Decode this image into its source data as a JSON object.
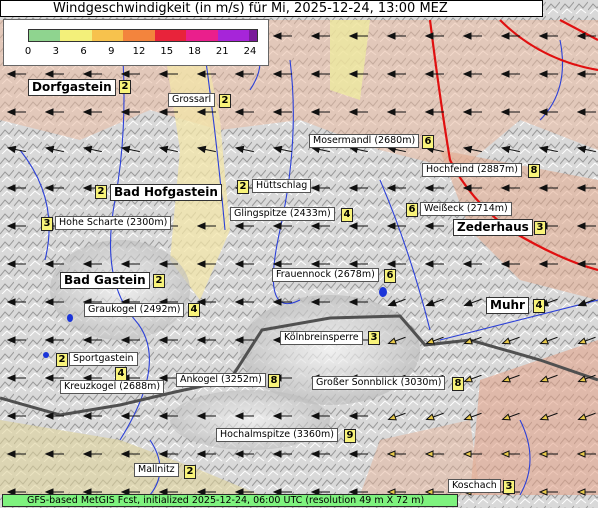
{
  "title": "Windgeschwindigkeit (in m/s) für Mi, 2025-12-24, 13:00 MEZ",
  "legend": {
    "ticks": [
      "0",
      "3",
      "6",
      "9",
      "12",
      "15",
      "18",
      "21",
      "24"
    ],
    "colors": [
      "#8fd48f",
      "#f3f07a",
      "#f7c24d",
      "#f3843d",
      "#e8233a",
      "#ea1f8c",
      "#a625d9",
      "#7a1b9a"
    ]
  },
  "towns": [
    {
      "name": "Dorfgastein",
      "value": "2"
    },
    {
      "name": "Bad Hofgastein",
      "value": "2"
    },
    {
      "name": "Bad Gastein",
      "value": "2"
    },
    {
      "name": "Zederhaus",
      "value": "3"
    },
    {
      "name": "Muhr",
      "value": "4"
    }
  ],
  "peaks": [
    {
      "name": "Grossarl",
      "value": "2"
    },
    {
      "name": "Mosermandl (2680m)",
      "value": "6"
    },
    {
      "name": "Hochfeind (2887m)",
      "value": "8"
    },
    {
      "name": "Hüttschlag",
      "value": "2"
    },
    {
      "name": "Weißeck (2714m)",
      "value": "6"
    },
    {
      "name": "Hohe Scharte (2300m)",
      "value": "3"
    },
    {
      "name": "Glingspitze (2433m)",
      "value": "4"
    },
    {
      "name": "Frauennock (2678m)",
      "value": "6"
    },
    {
      "name": "Graukogel (2492m)",
      "value": "4"
    },
    {
      "name": "Kölnbreinsperre",
      "value": "3"
    },
    {
      "name": "Sportgastein",
      "value": "2"
    },
    {
      "name": "Kreuzkogel (2688m)",
      "value": "4"
    },
    {
      "name": "Ankogel (3252m)",
      "value": "8"
    },
    {
      "name": "Großer Sonnblick (3030m)",
      "value": "8"
    },
    {
      "name": "Hochalmspitze (3360m)",
      "value": "9"
    },
    {
      "name": "Mallnitz",
      "value": "2"
    },
    {
      "name": "Koschach",
      "value": "3"
    }
  ],
  "footer": "GFS-based MetGIS Fcst, initialized 2025-12-24, 06:00 UTC  (resolution 49 m X 72 m)"
}
